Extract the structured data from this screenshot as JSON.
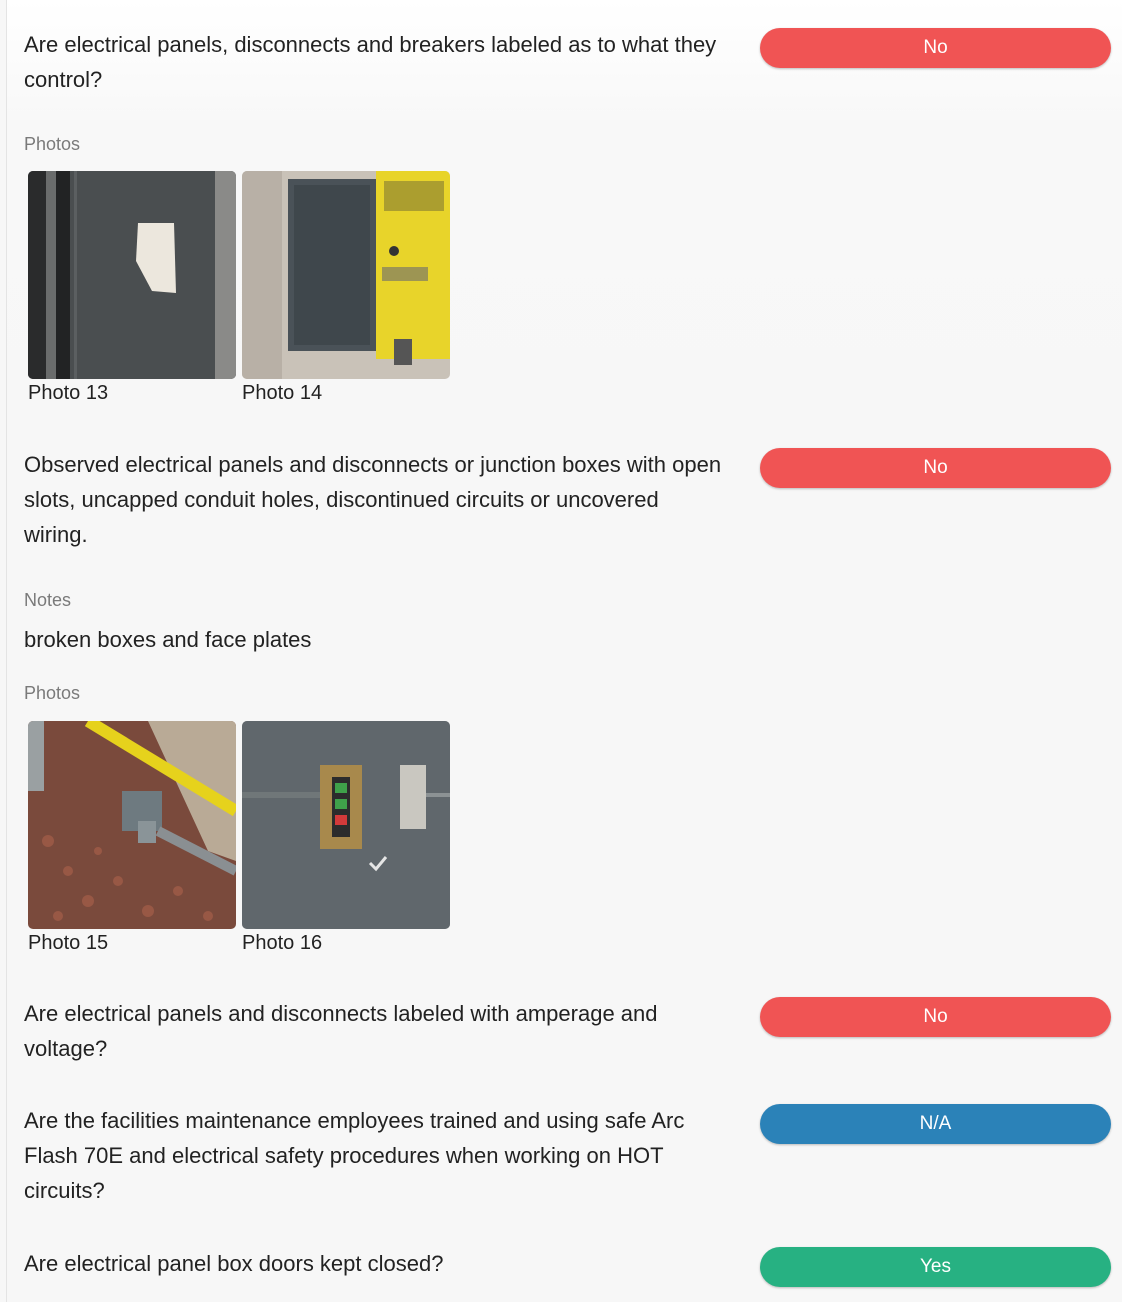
{
  "colors": {
    "no": "#f05454",
    "na": "#2b82b8",
    "yes": "#27b182"
  },
  "items": [
    {
      "question": "Are electrical panels, disconnects and breakers labeled as to what they control?",
      "answer": "No",
      "photos_label": "Photos",
      "photos": [
        {
          "caption": "Photo 13",
          "icon": "photo-dark-panel-door"
        },
        {
          "caption": "Photo 14",
          "icon": "photo-panel-with-yellow-sign"
        }
      ]
    },
    {
      "question": "Observed electrical panels and disconnects or junction boxes with open slots, uncapped conduit holes, discontinued circuits or uncovered wiring.",
      "answer": "No",
      "notes_label": "Notes",
      "notes": "broken boxes and face plates",
      "photos_label": "Photos",
      "photos": [
        {
          "caption": "Photo 15",
          "icon": "photo-conduit-on-gravel"
        },
        {
          "caption": "Photo 16",
          "icon": "photo-switch-box-on-wall"
        }
      ]
    },
    {
      "question": "Are electrical panels and disconnects labeled with amperage and voltage?",
      "answer": "No"
    },
    {
      "question": "Are the facilities maintenance employees trained and using safe Arc Flash 70E and electrical safety procedures when working on HOT circuits?",
      "answer": "N/A"
    },
    {
      "question": "Are electrical panel box doors kept closed?",
      "answer": "Yes"
    }
  ]
}
